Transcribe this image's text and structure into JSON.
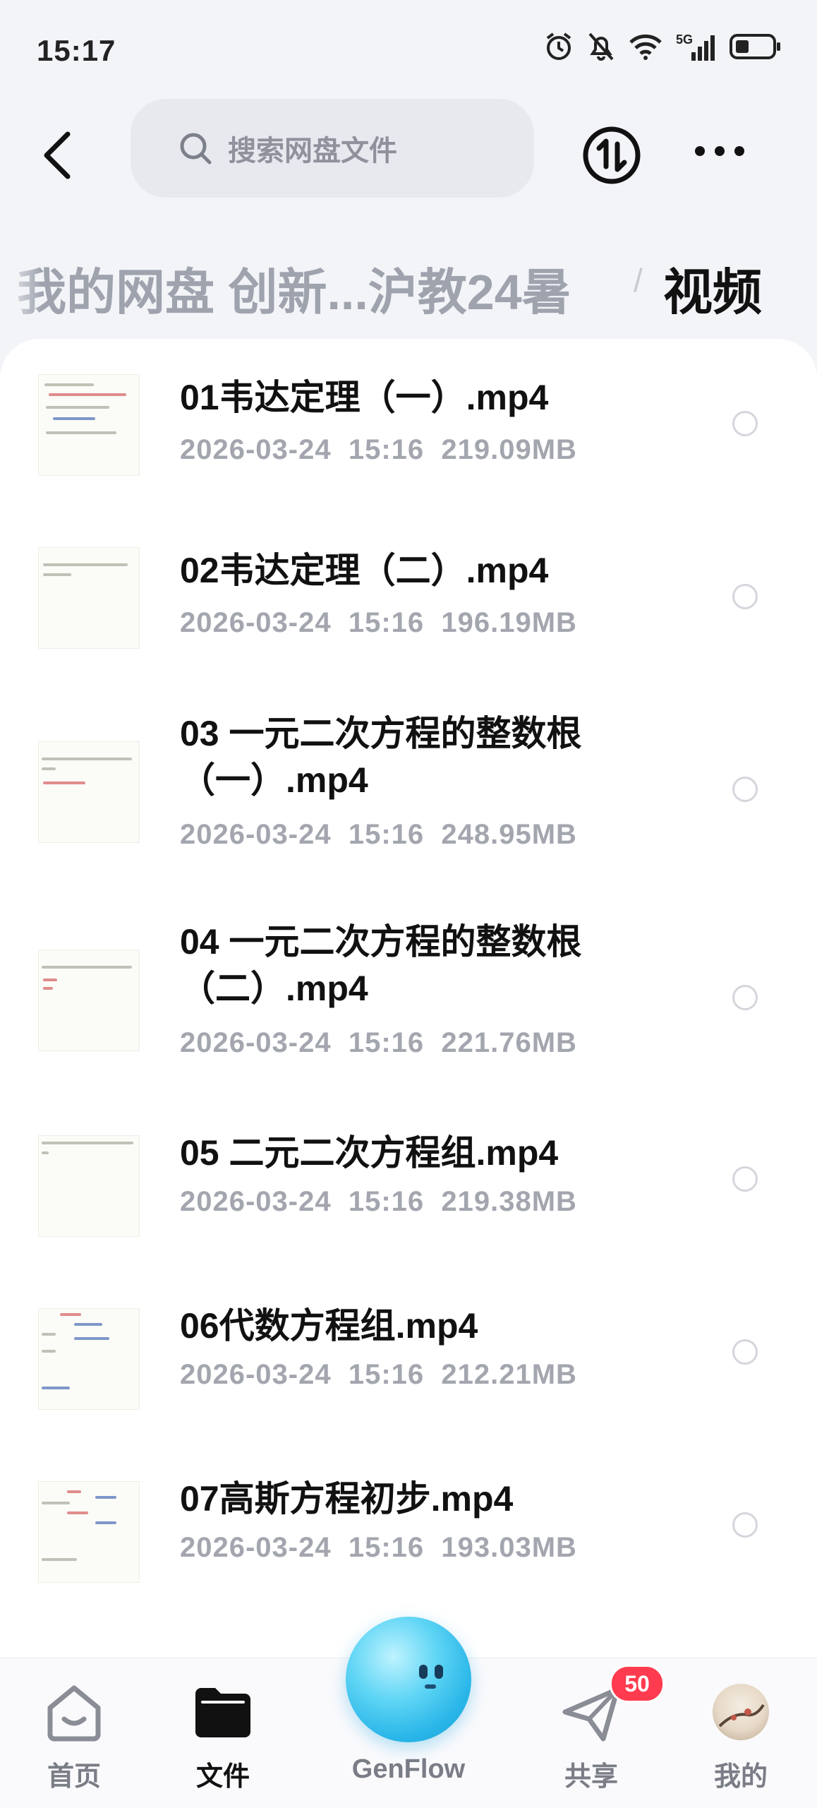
{
  "status_bar": {
    "time": "15:17",
    "icons": [
      "alarm-icon",
      "mute-icon",
      "wifi-icon",
      "5g-signal-icon",
      "battery-icon"
    ],
    "network_label": "5G"
  },
  "header": {
    "back_icon": "chevron-left-icon",
    "search_placeholder": "搜索网盘文件",
    "sync_icon": "transfer-icon",
    "more_icon": "more-dots-icon"
  },
  "breadcrumb": {
    "path": "我的网盘 创新...沪教24暑",
    "separator": "/",
    "current": "视频"
  },
  "files": [
    {
      "name": "01韦达定理（一）.mp4",
      "date": "2026-03-24",
      "time": "15:16",
      "size": "219.09MB"
    },
    {
      "name": "02韦达定理（二）.mp4",
      "date": "2026-03-24",
      "time": "15:16",
      "size": "196.19MB"
    },
    {
      "name": "03 一元二次方程的整数根（一）.mp4",
      "date": "2026-03-24",
      "time": "15:16",
      "size": "248.95MB"
    },
    {
      "name": "04 一元二次方程的整数根（二）.mp4",
      "date": "2026-03-24",
      "time": "15:16",
      "size": "221.76MB"
    },
    {
      "name": "05 二元二次方程组.mp4",
      "date": "2026-03-24",
      "time": "15:16",
      "size": "219.38MB"
    },
    {
      "name": "06代数方程组.mp4",
      "date": "2026-03-24",
      "time": "15:16",
      "size": "212.21MB"
    },
    {
      "name": "07高斯方程初步.mp4",
      "date": "2026-03-24",
      "time": "15:16",
      "size": "193.03MB"
    }
  ],
  "bottom_nav": {
    "home": "首页",
    "files": "文件",
    "genflow": "GenFlow",
    "share": "共享",
    "share_badge": "50",
    "me": "我的",
    "active": "files"
  },
  "colors": {
    "accent_text": "#111111",
    "muted_text": "#a3a6ae",
    "badge": "#ff3b4f",
    "genflow": "#2ab6e8"
  }
}
